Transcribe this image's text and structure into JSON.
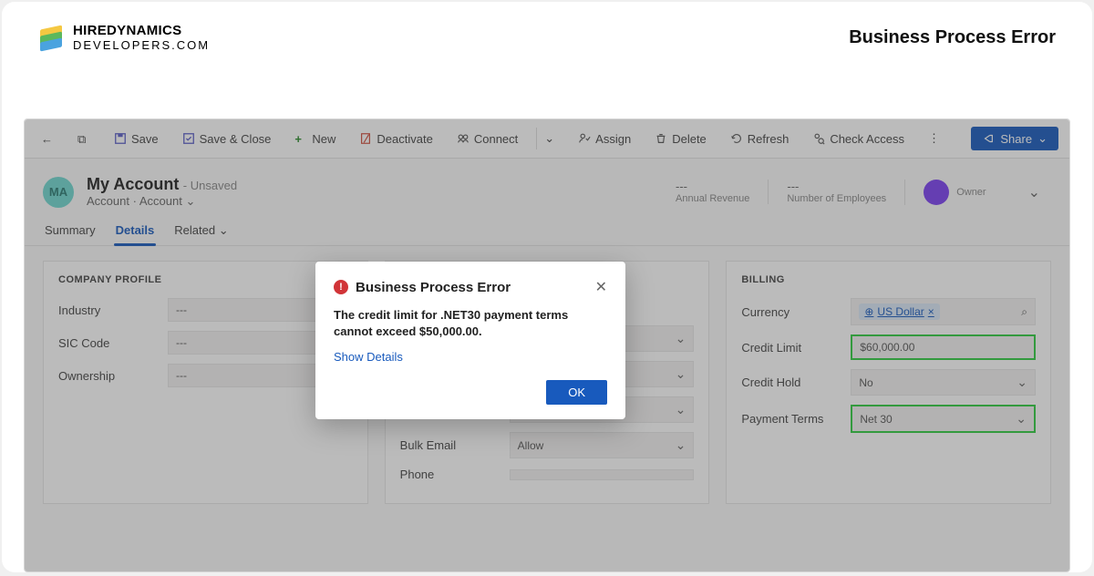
{
  "logo": {
    "line1": "HIREDYNAMICS",
    "line2": "DEVELOPERS.COM"
  },
  "page_title": "Business Process Error",
  "toolbar": {
    "save": "Save",
    "save_close": "Save & Close",
    "new": "New",
    "deactivate": "Deactivate",
    "connect": "Connect",
    "assign": "Assign",
    "delete": "Delete",
    "refresh": "Refresh",
    "check_access": "Check Access",
    "share": "Share"
  },
  "record": {
    "avatar": "MA",
    "title": "My Account",
    "unsaved": "- Unsaved",
    "sub1": "Account",
    "sub2": "Account",
    "annual_revenue_val": "---",
    "annual_revenue_lab": "Annual Revenue",
    "employees_val": "---",
    "employees_lab": "Number of Employees",
    "owner_lab": "Owner"
  },
  "tabs": {
    "summary": "Summary",
    "details": "Details",
    "related": "Related"
  },
  "company": {
    "title": "COMPANY PROFILE",
    "industry": "Industry",
    "industry_val": "---",
    "sic": "SIC Code",
    "sic_val": "---",
    "ownership": "Ownership",
    "ownership_val": "---"
  },
  "middle": {
    "bulk_email": "Bulk Email",
    "bulk_email_val": "Allow",
    "phone": "Phone"
  },
  "billing": {
    "title": "BILLING",
    "currency": "Currency",
    "currency_val": "US Dollar",
    "credit_limit": "Credit Limit",
    "credit_limit_val": "$60,000.00",
    "credit_hold": "Credit Hold",
    "credit_hold_val": "No",
    "payment_terms": "Payment Terms",
    "payment_terms_val": "Net 30"
  },
  "dialog": {
    "title": "Business Process Error",
    "body": "The credit limit for .NET30 payment terms cannot exceed $50,000.00.",
    "show_details": "Show Details",
    "ok": "OK"
  }
}
